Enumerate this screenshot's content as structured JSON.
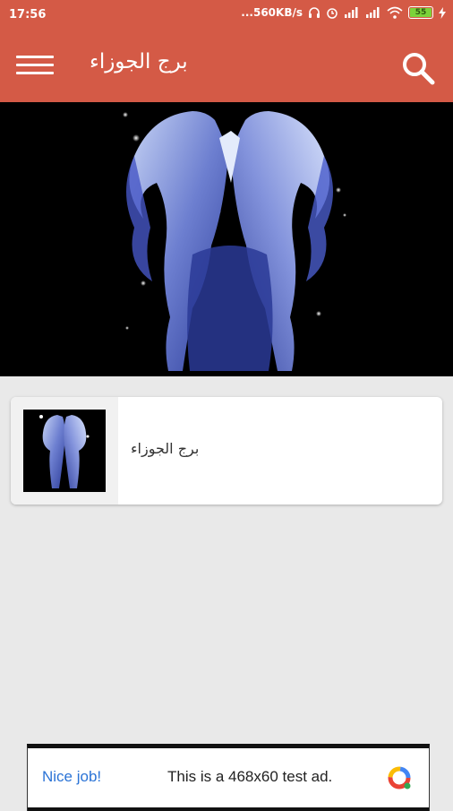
{
  "status_bar": {
    "time": "17:56",
    "network_speed": "...560KB/s",
    "battery": "55"
  },
  "app_bar": {
    "title": "برج الجوزاء",
    "menu_icon": "hamburger-menu-icon",
    "search_icon": "search-icon"
  },
  "list": {
    "items": [
      {
        "title": "برج الجوزاء"
      }
    ]
  },
  "ad": {
    "left_text": "Nice job!",
    "main_text": "This is a 468x60 test ad."
  },
  "colors": {
    "primary": "#d45a46",
    "background": "#e9e9e9",
    "ad_link": "#2a73d6"
  }
}
